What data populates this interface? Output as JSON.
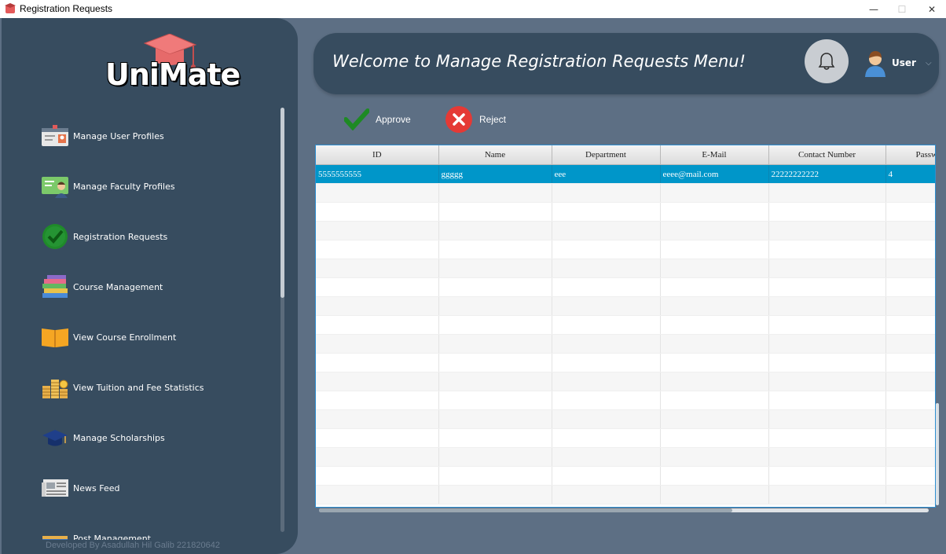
{
  "window": {
    "title": "Registration Requests",
    "minimize": "—",
    "maximize": "☐",
    "close": "✕"
  },
  "logo": {
    "text": "UniMate"
  },
  "sidebar": {
    "items": [
      {
        "label": "Manage User Profiles",
        "icon": "id-card-icon"
      },
      {
        "label": "Manage Faculty Profiles",
        "icon": "faculty-card-icon"
      },
      {
        "label": "Registration Requests",
        "icon": "check-badge-icon"
      },
      {
        "label": "Course Management",
        "icon": "books-stack-icon"
      },
      {
        "label": "View Course Enrollment",
        "icon": "open-book-icon"
      },
      {
        "label": "View Tuition and Fee Statistics",
        "icon": "coins-icon"
      },
      {
        "label": "Manage Scholarships",
        "icon": "graduation-cap-icon"
      },
      {
        "label": "News Feed",
        "icon": "newspaper-icon"
      },
      {
        "label": "Post Management",
        "icon": "post-icon"
      }
    ],
    "footer": "Developed By Asadullah Hil Galib 221820642"
  },
  "header": {
    "welcome": "Welcome to Manage Registration Requests Menu!",
    "user": "User"
  },
  "actions": {
    "approve": "Approve",
    "reject": "Reject"
  },
  "table": {
    "columns": [
      "ID",
      "Name",
      "Department",
      "E-Mail",
      "Contact Number",
      "Passw"
    ],
    "rows": [
      [
        "5555555555",
        "ggggg",
        "eee",
        "eeee@mail.com",
        "22222222222",
        "4"
      ]
    ]
  },
  "colors": {
    "sidebar": "#374c5f",
    "content_bg": "#5d6f84",
    "selection": "#0096c9",
    "approve": "#1e8a24",
    "reject": "#e53935"
  }
}
